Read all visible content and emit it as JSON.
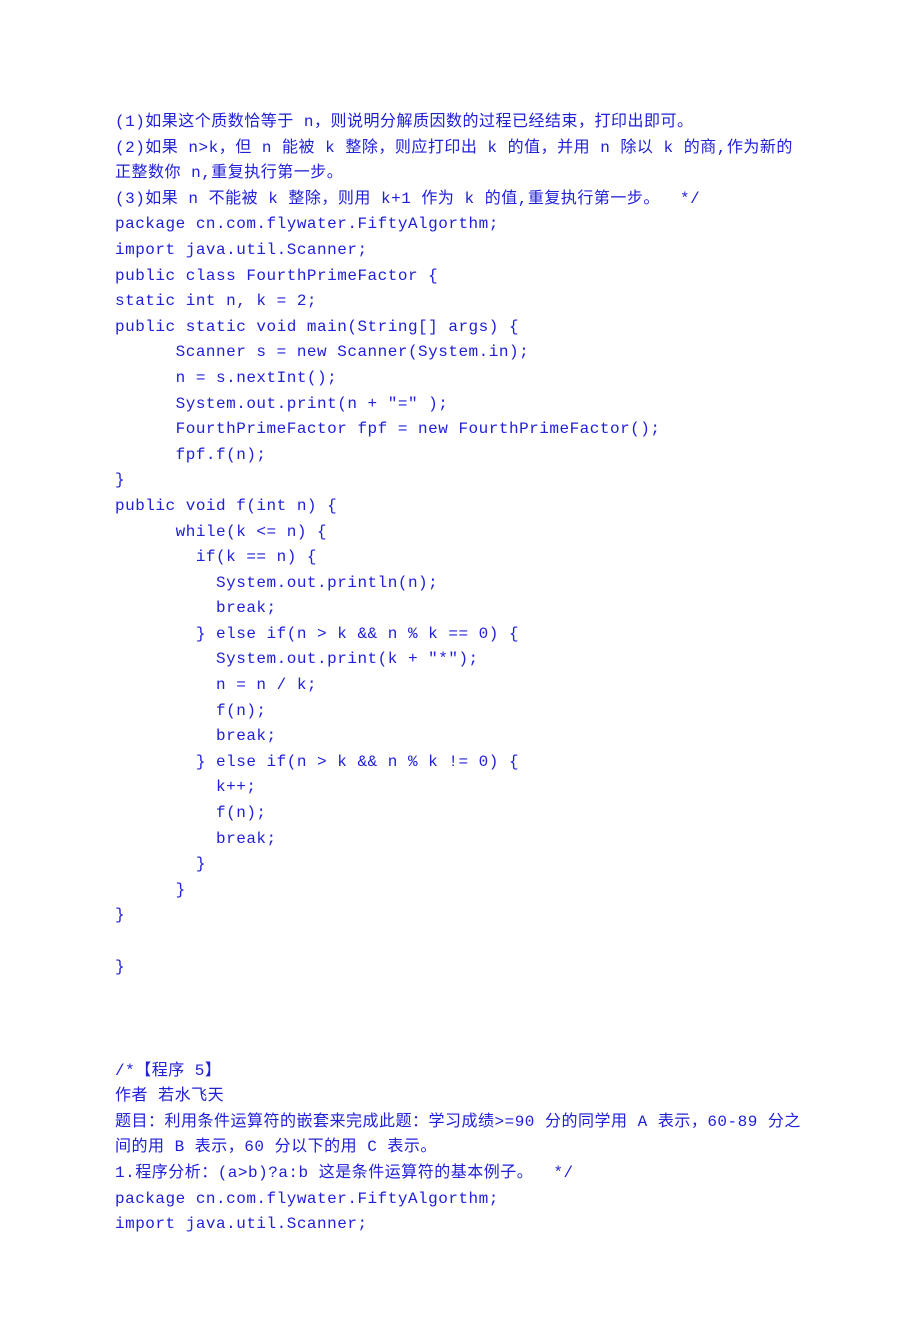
{
  "lines": [
    "(1)如果这个质数恰等于 n，则说明分解质因数的过程已经结束，打印出即可。",
    "(2)如果 n>k，但 n 能被 k 整除，则应打印出 k 的值，并用 n 除以 k 的商,作为新的正整数你 n,重复执行第一步。",
    "(3)如果 n 不能被 k 整除，则用 k+1 作为 k 的值,重复执行第一步。  */",
    "package cn.com.flywater.FiftyAlgorthm;",
    "import java.util.Scanner;",
    "public class FourthPrimeFactor {",
    "static int n, k = 2;",
    "public static void main(String[] args) {",
    "      Scanner s = new Scanner(System.in);",
    "      n = s.nextInt();",
    "      System.out.print(n + \"=\" );",
    "      FourthPrimeFactor fpf = new FourthPrimeFactor();",
    "      fpf.f(n);",
    "}",
    "public void f(int n) {",
    "      while(k <= n) {",
    "        if(k == n) {",
    "          System.out.println(n);",
    "          break;",
    "        } else if(n > k && n % k == 0) {",
    "          System.out.print(k + \"*\");",
    "          n = n / k;",
    "          f(n);",
    "          break;",
    "        } else if(n > k && n % k != 0) {",
    "          k++;",
    "          f(n);",
    "          break;",
    "        }",
    "      }",
    "}",
    "",
    "}",
    "",
    "",
    "",
    "/*【程序 5】",
    "作者 若水飞天",
    "题目：利用条件运算符的嵌套来完成此题：学习成绩>=90 分的同学用 A 表示，60-89 分之间的用 B 表示，60 分以下的用 C 表示。",
    "1.程序分析：(a>b)?a:b 这是条件运算符的基本例子。  */",
    "package cn.com.flywater.FiftyAlgorthm;",
    "import java.util.Scanner;"
  ]
}
